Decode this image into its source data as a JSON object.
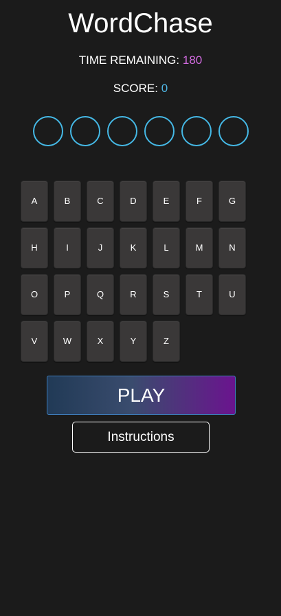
{
  "game": {
    "title": "WordChase",
    "time_label": "TIME REMAINING:",
    "time_value": "180",
    "score_label": "SCORE:",
    "score_value": "0",
    "slot_count": 6
  },
  "keyboard": {
    "rows": [
      [
        "A",
        "B",
        "C",
        "D",
        "E",
        "F",
        "G"
      ],
      [
        "H",
        "I",
        "J",
        "K",
        "L",
        "M",
        "N"
      ],
      [
        "O",
        "P",
        "Q",
        "R",
        "S",
        "T",
        "U"
      ],
      [
        "V",
        "W",
        "X",
        "Y",
        "Z"
      ]
    ]
  },
  "buttons": {
    "play_label": "PLAY",
    "instructions_label": "Instructions"
  },
  "colors": {
    "background": "#1b1b1b",
    "time_value": "#d26be0",
    "score_value": "#4fb6e4",
    "slot_border": "#45b9e6",
    "key_background": "#3a3838",
    "play_gradient_start": "#213a56",
    "play_gradient_end": "#6a148e"
  }
}
